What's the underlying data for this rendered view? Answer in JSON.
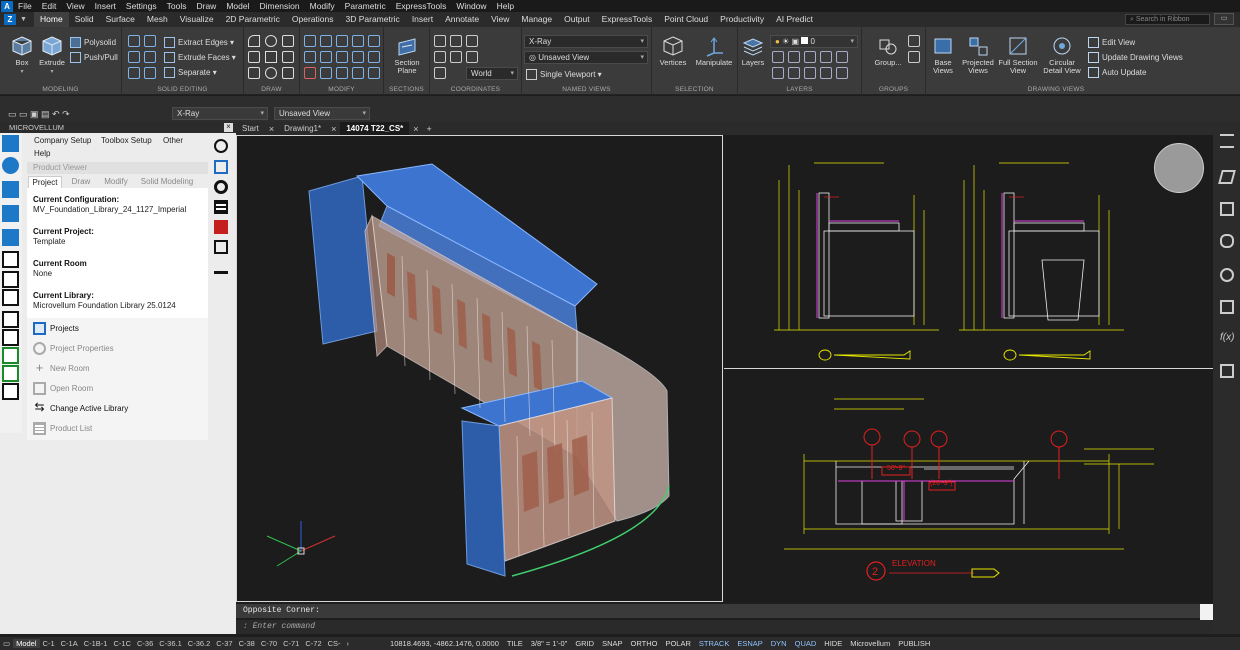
{
  "menu": [
    "File",
    "Edit",
    "View",
    "Insert",
    "Settings",
    "Tools",
    "Draw",
    "Model",
    "Dimension",
    "Modify",
    "Parametric",
    "ExpressTools",
    "Window",
    "Help"
  ],
  "ribbon_tabs": [
    "Home",
    "Solid",
    "Surface",
    "Mesh",
    "Visualize",
    "2D Parametric",
    "Operations",
    "3D Parametric",
    "Insert",
    "Annotate",
    "View",
    "Manage",
    "Output",
    "ExpressTools",
    "Point Cloud",
    "Productivity",
    "AI Predict"
  ],
  "active_tab": "Home",
  "search_placeholder": "Search in Ribbon",
  "ribbon": {
    "modeling": {
      "title": "MODELING",
      "box": "Box",
      "extrude": "Extrude",
      "polysolid": "Polysolid",
      "pushpull": "Push/Pull"
    },
    "solid_editing": {
      "title": "SOLID EDITING",
      "extract_edges": "Extract Edges",
      "extrude_faces": "Extrude Faces",
      "separate": "Separate"
    },
    "draw": {
      "title": "DRAW"
    },
    "modify": {
      "title": "MODIFY"
    },
    "sections": {
      "title": "SECTIONS",
      "section_plane": "Section Plane"
    },
    "coordinates": {
      "title": "COORDINATES",
      "world": "World"
    },
    "named_views": {
      "title": "NAMED VIEWS",
      "visual_style": "X-Ray",
      "view": "Unsaved View",
      "viewport": "Single Viewport"
    },
    "selection": {
      "title": "SELECTION",
      "vertices": "Vertices",
      "manipulate": "Manipulate"
    },
    "layers": {
      "title": "LAYERS",
      "layers": "Layers",
      "layer_value": "0"
    },
    "groups": {
      "title": "GROUPS",
      "group": "Group..."
    },
    "drawing_views": {
      "title": "DRAWING VIEWS",
      "base_views": "Base Views",
      "projected_views": "Projected Views",
      "full_section_view": "Full Section View",
      "circular_detail_view": "Circular Detail View",
      "edit_view": "Edit View",
      "update_drawing_views": "Update Drawing Views",
      "auto_update": "Auto Update"
    }
  },
  "toolbar2": {
    "visual_style": "X-Ray",
    "view": "Unsaved View"
  },
  "palette": {
    "header": "MICROVELLUM",
    "menus": [
      "Company Setup",
      "Toolbox Setup",
      "Other",
      "Help"
    ],
    "product_viewer": "Product Viewer",
    "tabs": [
      "Project",
      "Draw",
      "Modify",
      "Solid Modeling"
    ],
    "fields": [
      {
        "label": "Current Configuration:",
        "value": "MV_Foundation_Library_24_1127_Imperial"
      },
      {
        "label": "Current Project:",
        "value": "Template"
      },
      {
        "label": "Current Room",
        "value": "None"
      },
      {
        "label": "Current Library:",
        "value": "Microvellum Foundation Library 25.0124"
      }
    ],
    "actions": [
      "Projects",
      "Project Properties",
      "New Room",
      "Open Room",
      "Change Active Library",
      "Product List"
    ]
  },
  "doc_tabs": [
    "Start",
    "Drawing1*",
    "14074 T22_CS*"
  ],
  "drawing": {
    "elevation_number": "2",
    "elevation_title": "ELEVATION",
    "dim1": "50'-9\"",
    "dim2": "(20'-9\")"
  },
  "command": {
    "history": "Opposite Corner:",
    "prompt": "Enter command"
  },
  "status": {
    "layouts": [
      "Model",
      "C-1",
      "C-1A",
      "C-1B-1",
      "C-1C",
      "C-36",
      "C-36.1",
      "C-36.2",
      "C-37",
      "C-38",
      "C-70",
      "C-71",
      "C-72",
      "CS-"
    ],
    "coords": "10818.4693, -4862.1476, 0.0000",
    "toggles": [
      "TILE",
      "3/8\" = 1'-0\"",
      "GRID",
      "SNAP",
      "ORTHO",
      "POLAR",
      "STRACK",
      "ESNAP",
      "DYN",
      "QUAD",
      "HIDE",
      "Microvellum",
      "PUBLISH"
    ]
  },
  "colors": {
    "accent": "#0a6bc2",
    "viewport_bg": "#1c1c1c",
    "cad_yellow": "#e6e600",
    "cad_red": "#e02020",
    "cad_magenta": "#e040e0"
  }
}
